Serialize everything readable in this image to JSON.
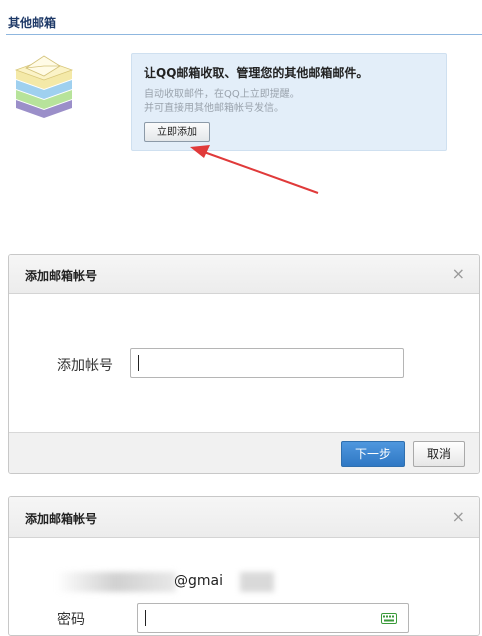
{
  "section": {
    "title": "其他邮箱"
  },
  "promo": {
    "title": "让QQ邮箱收取、管理您的其他邮箱邮件。",
    "line1": "自动收取邮件，在QQ上立即提醒。",
    "line2": "并可直接用其他邮箱帐号发信。",
    "button": "立即添加"
  },
  "dialog1": {
    "title": "添加邮箱帐号",
    "close": "×",
    "field_label": "添加帐号",
    "field_value": "",
    "next": "下一步",
    "cancel": "取消"
  },
  "dialog2": {
    "title": "添加邮箱帐号",
    "close": "×",
    "email_partial": "@gmai",
    "password_label": "密码",
    "password_value": ""
  },
  "colors": {
    "primary_button": "#3a83cf",
    "header_rule": "#8fb7df",
    "promo_bg": "#e3eef9",
    "arrow": "#e03a3a"
  },
  "icons": {
    "stack": "mail-stack-icon",
    "close": "close-icon",
    "keyboard": "keyboard-icon",
    "arrow": "pointer-arrow"
  }
}
